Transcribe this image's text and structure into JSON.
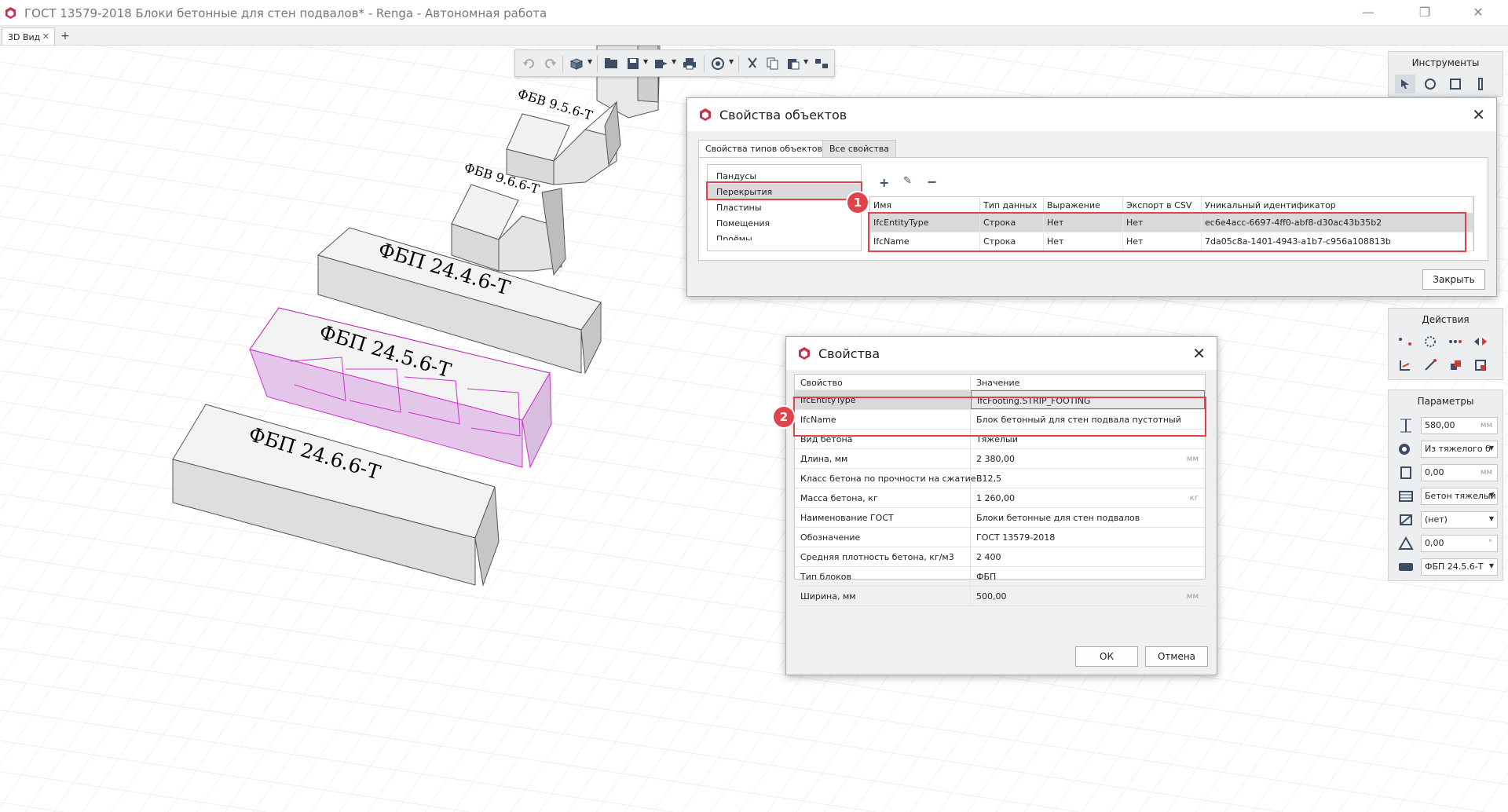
{
  "window": {
    "title": "ГОСТ 13579-2018 Блоки бетонные для стен подвалов* - Renga - Автономная работа",
    "minimize": "—",
    "restore": "❐",
    "close": "✕"
  },
  "tabs": {
    "view_tab": "3D Вид",
    "close": "✕",
    "add": "+"
  },
  "scene_labels": [
    "ФБВ 9.5.6-Т",
    "ФБВ 9.6.6-Т",
    "ФБП 24.4.6-Т",
    "ФБП 24.5.6-Т",
    "ФБП 24.6.6-Т"
  ],
  "panels": {
    "tools": {
      "title": "Инструменты"
    },
    "actions": {
      "title": "Действия"
    },
    "params": {
      "title": "Параметры",
      "rows": [
        {
          "value": "580,00",
          "unit": "мм"
        },
        {
          "value": "Из тяжелого б",
          "dropdown": true
        },
        {
          "value": "0,00",
          "unit": "мм"
        },
        {
          "value": "Бетон тяжелый",
          "dropdown": true
        },
        {
          "value": "(нет)",
          "dropdown": true
        },
        {
          "value": "0,00",
          "unit": "°"
        },
        {
          "value": "ФБП 24.5.6-Т",
          "dropdown": true
        }
      ]
    }
  },
  "obj_dialog": {
    "title": "Свойства объектов",
    "tabs": [
      "Свойства типов объектов",
      "Все свойства"
    ],
    "list_items": [
      "Пандусы",
      "Перекрытия",
      "Пластины",
      "Помещения",
      "Проёмы"
    ],
    "selected_item": "Перекрытия",
    "columns": [
      "Имя",
      "Тип данных",
      "Выражение",
      "Экспорт в CSV",
      "Уникальный идентификатор"
    ],
    "rows": [
      [
        "IfcEntityType",
        "Строка",
        "Нет",
        "Нет",
        "ec6e4acc-6697-4ff0-abf8-d30ac43b35b2"
      ],
      [
        "IfcName",
        "Строка",
        "Нет",
        "Нет",
        "7da05c8a-1401-4943-a1b7-c956a108813b"
      ]
    ],
    "close_btn": "Закрыть",
    "badge": "1"
  },
  "props_dialog": {
    "title": "Свойства",
    "col_key": "Свойство",
    "col_value": "Значение",
    "rows": [
      {
        "k": "IfcEntityType",
        "v": "IfcFooting.STRIP_FOOTING"
      },
      {
        "k": "IfcName",
        "v": "Блок бетонный для стен подвала пустотный"
      },
      {
        "k": "Вид бетона",
        "v": "Тяжелый"
      },
      {
        "k": "Длина, мм",
        "v": "2 380,00",
        "u": "мм"
      },
      {
        "k": "Класс бетона по прочности на сжатие",
        "v": "B12,5"
      },
      {
        "k": "Масса бетона, кг",
        "v": "1 260,00",
        "u": "кг"
      },
      {
        "k": "Наименование ГОСТ",
        "v": "Блоки бетонные для стен подвалов"
      },
      {
        "k": "Обозначение",
        "v": "ГОСТ 13579-2018"
      },
      {
        "k": "Средняя плотность бетона, кг/м3",
        "v": "2 400"
      },
      {
        "k": "Тип блоков",
        "v": "ФБП"
      },
      {
        "k": "Ширина, мм",
        "v": "500,00",
        "u": "мм"
      }
    ],
    "ok": "ОК",
    "cancel": "Отмена",
    "badge": "2"
  }
}
